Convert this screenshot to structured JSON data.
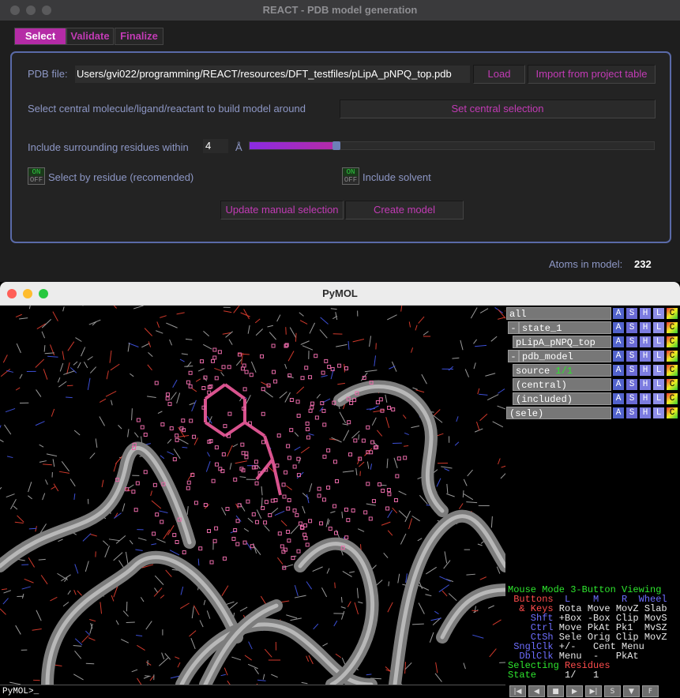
{
  "react_window": {
    "title": "REACT - PDB model generation",
    "tabs": [
      "Select",
      "Validate",
      "Finalize"
    ],
    "pdb_file_label": "PDB file:",
    "pdb_file_path": "Users/gvi022/programming/REACT/resources/DFT_testfiles/pLipA_pNPQ_top.pdb",
    "load_button": "Load",
    "import_button": "Import from project table",
    "central_label": "Select central molecule/ligand/reactant to build model around",
    "set_central_button": "Set central selection",
    "surrounding_label": "Include surrounding residues within",
    "radius_value": "4",
    "radius_unit": "Å",
    "radius_fraction": 0.21,
    "toggle_on_text": "ON",
    "toggle_off_text": "OFF",
    "select_by_residue_label": "Select by residue (recomended)",
    "include_solvent_label": "Include solvent",
    "update_button": "Update manual selection",
    "create_button": "Create model",
    "atoms_label": "Atoms in model:",
    "atoms_value": "232"
  },
  "pymol_window": {
    "title": "PyMOL",
    "command_prompt": "PyMOL>_",
    "objects": [
      {
        "name": "all",
        "indent": 0,
        "expander": ""
      },
      {
        "name": "state_1",
        "indent": 1,
        "expander": "-"
      },
      {
        "name": "pLipA_pNPQ_top",
        "indent": 2,
        "expander": ""
      },
      {
        "name": "pdb_model",
        "indent": 1,
        "expander": "-"
      },
      {
        "name": "source 1/1",
        "indent": 2,
        "expander": ""
      },
      {
        "name": "(central)",
        "indent": 2,
        "expander": ""
      },
      {
        "name": "(included)",
        "indent": 2,
        "expander": ""
      },
      {
        "name": "(sele)",
        "indent": 0,
        "expander": ""
      }
    ],
    "object_buttons": [
      "A",
      "S",
      "H",
      "L",
      "C"
    ],
    "mouse_info": {
      "mode_line": [
        "Mouse Mode ",
        "3-Button Viewing"
      ],
      "header": [
        " Buttons",
        "  L    M    R  Wheel"
      ],
      "rows": [
        [
          "  & Keys",
          " Rota Move MovZ Slab"
        ],
        [
          "    Shft",
          " +Box -Box Clip MovS"
        ],
        [
          "    Ctrl",
          " Move PkAt Pk1  MvSZ"
        ],
        [
          "    CtSh",
          " Sele Orig Clip MovZ"
        ],
        [
          " SnglClk",
          " +/-   Cent Menu"
        ],
        [
          "  DblClk",
          " Menu  -   PkAt"
        ]
      ],
      "selecting": [
        "Selecting ",
        "Residues"
      ],
      "state": [
        "State",
        "     1/   1"
      ]
    },
    "vcr_buttons": [
      "|◀",
      "◀",
      "■",
      "▶",
      "▶|",
      "S",
      "▼",
      "F"
    ]
  }
}
